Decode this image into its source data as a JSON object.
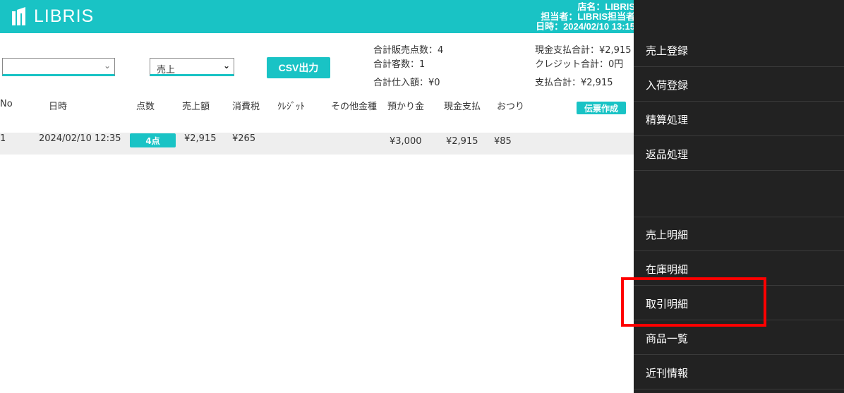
{
  "header": {
    "logo_text": "LIBRIS",
    "store_line": "店名：LIBRIS",
    "staff_line": "担当者：LIBRIS担当者",
    "datetime_line": "日時：2024/02/10 13:15",
    "bg_color": "#19c3c5"
  },
  "filters": {
    "select1_value": "",
    "select2_value": "売上",
    "csv_button": "CSV出力"
  },
  "summary": {
    "total_items": "合計販売点数：4",
    "total_customers": "合計客数：1",
    "total_purchase": "合計仕入額：¥0",
    "cash_total": "現金支払合計：¥2,915",
    "credit_total": "クレジット合計：0円",
    "payment_total": "支払合計：¥2,915"
  },
  "table": {
    "columns": [
      "No",
      "日時",
      "点数",
      "売上額",
      "消費税",
      "ｸﾚｼﾞｯﾄ",
      "その他金種",
      "預かり金",
      "現金支払",
      "おつり"
    ],
    "slip_button": "伝票作成",
    "rows": [
      {
        "no": "1",
        "datetime": "2024/02/10 12:35",
        "count": "4点",
        "sales": "¥2,915",
        "tax": "¥265",
        "credit": "",
        "other": "",
        "deposit": "¥3,000",
        "cash": "¥2,915",
        "change": "¥85"
      }
    ]
  },
  "sidebar": {
    "items": [
      {
        "label": "売上登録"
      },
      {
        "label": "入荷登録"
      },
      {
        "label": "精算処理"
      },
      {
        "label": "返品処理"
      },
      {
        "label": ""
      },
      {
        "label": "売上明細"
      },
      {
        "label": "在庫明細"
      },
      {
        "label": "取引明細"
      },
      {
        "label": "商品一覧"
      },
      {
        "label": "近刊情報"
      }
    ]
  },
  "highlight_color": "#ff0000"
}
